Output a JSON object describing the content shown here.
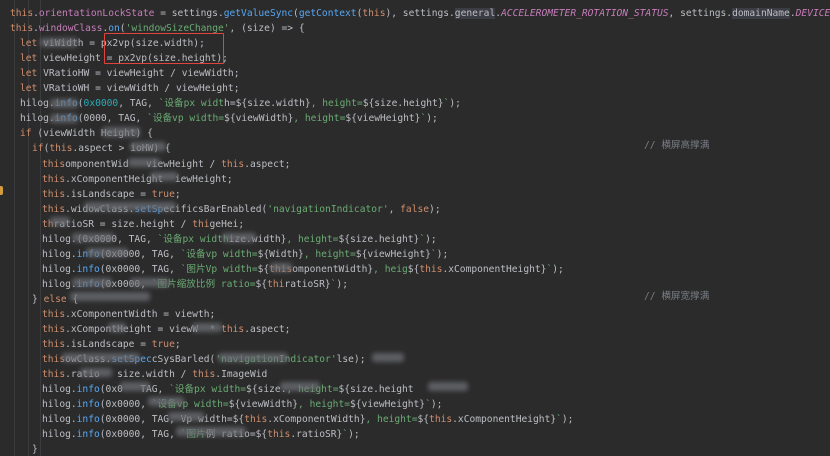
{
  "editor": {
    "lines": [
      {
        "indent": 0,
        "tokens": [
          [
            "kw",
            "this"
          ],
          [
            "",
            "."
          ],
          [
            "fld",
            "orientationLockState"
          ],
          [
            "",
            " = settings."
          ],
          [
            "fn",
            "getValueSync"
          ],
          [
            "",
            "("
          ],
          [
            "fn",
            "getContext"
          ],
          [
            "",
            "("
          ],
          [
            "kw",
            "this"
          ],
          [
            "",
            "), settings."
          ],
          [
            "hl",
            "general"
          ],
          [
            "",
            "."
          ],
          [
            "cst",
            "ACCELEROMETER_ROTATION_STATUS"
          ],
          [
            "",
            ", settings."
          ],
          [
            "hl",
            "domainName"
          ],
          [
            "",
            "."
          ],
          [
            "cst",
            "DEVICE_SHARED"
          ],
          [
            "",
            "};"
          ]
        ]
      },
      {
        "indent": 0,
        "tokens": [
          [
            "kw",
            "this"
          ],
          [
            "",
            "."
          ],
          [
            "fld",
            "windowClass"
          ],
          [
            "",
            "."
          ],
          [
            "fn",
            "on"
          ],
          [
            "",
            "("
          ],
          [
            "str",
            "'windowSizeChange'"
          ],
          [
            "",
            ", (size) => {"
          ]
        ]
      },
      {
        "indent": 1,
        "tokens": [
          [
            "kw",
            "let"
          ],
          [
            "",
            " vi"
          ],
          [
            "",
            ""
          ],
          [
            "",
            "Width = "
          ],
          [
            "ab",
            "px2vp(size.width);"
          ]
        ]
      },
      {
        "indent": 1,
        "tokens": [
          [
            "kw",
            "let"
          ],
          [
            "",
            " viewHeight = "
          ],
          [
            "ab",
            "px2vp(size.height);"
          ]
        ]
      },
      {
        "indent": 1,
        "tokens": [
          [
            "kw",
            "let"
          ],
          [
            "",
            " VRatioHW = viewHeight / viewWidth;"
          ]
        ]
      },
      {
        "indent": 1,
        "tokens": [
          [
            "kw",
            "let"
          ],
          [
            "",
            " VRatioWH = viewWidth / viewHeight;"
          ]
        ]
      },
      {
        "indent": 1,
        "tokens": [
          [
            "",
            "hilog."
          ],
          [
            "fn",
            "info"
          ],
          [
            "",
            "("
          ],
          [
            "num",
            "0x0000"
          ],
          [
            "",
            ", TAG, "
          ],
          [
            "str",
            "`设备px widt"
          ],
          [
            "",
            "h="
          ],
          [
            "",
            "${size.width}"
          ],
          [
            "str",
            ", height="
          ],
          [
            "",
            "${size.height}"
          ],
          [
            "str",
            "`"
          ],
          [
            "",
            ");"
          ]
        ]
      },
      {
        "indent": 1,
        "tokens": [
          [
            "",
            "hilog."
          ],
          [
            "fn",
            "info"
          ],
          [
            "",
            "("
          ],
          [
            "",
            "0000"
          ],
          [
            "",
            ", TAG, "
          ],
          [
            "str",
            "`设备vp width="
          ],
          [
            "",
            "${viewWidth}"
          ],
          [
            "str",
            ", height="
          ],
          [
            "",
            "${viewHeight}"
          ],
          [
            "str",
            "`"
          ],
          [
            "",
            ");"
          ]
        ]
      },
      {
        "indent": 1,
        "tokens": [
          [
            "kw",
            "if"
          ],
          [
            "",
            " (viewWidth "
          ],
          [
            "",
            "Height) {"
          ]
        ]
      },
      {
        "indent": 2,
        "tokens": [
          [
            "kw",
            "if"
          ],
          [
            "",
            "("
          ],
          [
            "kw",
            "this"
          ],
          [
            "",
            ".aspect > "
          ],
          [
            "",
            "ioHW) {"
          ]
        ]
      },
      {
        "indent": 3,
        "tokens": [
          [
            "kw",
            "this"
          ],
          [
            "",
            "omponentWid"
          ],
          [
            "",
            "   viewHeight / "
          ],
          [
            "kw",
            "this"
          ],
          [
            "",
            ".aspect;"
          ]
        ]
      },
      {
        "indent": 3,
        "tokens": [
          [
            "kw",
            "this"
          ],
          [
            "",
            ".xComponentHeight  "
          ],
          [
            "",
            "iewHeight;"
          ]
        ]
      },
      {
        "indent": 3,
        "tokens": [
          [
            "kw",
            "this"
          ],
          [
            "",
            ".isLandscape = "
          ],
          [
            "kw",
            "true"
          ],
          [
            "",
            ";"
          ]
        ]
      },
      {
        "indent": 3,
        "tokens": [
          [
            "kw",
            "this"
          ],
          [
            "",
            ".wi"
          ],
          [
            "",
            "dowClass."
          ],
          [
            "fn",
            "setSp"
          ],
          [
            "",
            "ecifics"
          ],
          [
            "",
            "BarEnabled("
          ],
          [
            "str",
            "'navigationIndicator'"
          ],
          [
            "",
            ", "
          ],
          [
            "kw",
            "false"
          ],
          [
            "",
            ");"
          ]
        ]
      },
      {
        "indent": 3,
        "tokens": [
          [
            "kw",
            "th"
          ],
          [
            "",
            "ratioSR = size.height / "
          ],
          [
            "kw",
            "thi"
          ],
          [
            "",
            "geHei;"
          ]
        ]
      },
      {
        "indent": 3,
        "tokens": [
          [
            "",
            "hilog."
          ],
          [
            "",
            "(0x0000, TAG, "
          ],
          [
            "str",
            "`设备px width"
          ],
          [
            "",
            "ize.width}"
          ],
          [
            "str",
            ", height="
          ],
          [
            "",
            "${size.height}"
          ],
          [
            "str",
            "`"
          ],
          [
            "",
            ");"
          ]
        ]
      },
      {
        "indent": 3,
        "tokens": [
          [
            "",
            "hilog."
          ],
          [
            "fn",
            "info"
          ],
          [
            "",
            "(0x0000, TAG, "
          ],
          [
            "str",
            "`设备vp width="
          ],
          [
            "",
            "${"
          ],
          [
            "",
            "Width}"
          ],
          [
            "str",
            ", height="
          ],
          [
            "",
            "${viewHeight}"
          ],
          [
            "str",
            "`"
          ],
          [
            "",
            ");"
          ]
        ]
      },
      {
        "indent": 3,
        "tokens": [
          [
            "",
            "hilog."
          ],
          [
            "fn",
            "info"
          ],
          [
            "",
            "(0x0000, TAG, "
          ],
          [
            "str",
            "`图片Vp "
          ],
          [
            "str",
            "width="
          ],
          [
            "",
            "${"
          ],
          [
            "kw",
            "this"
          ],
          [
            "",
            "omponentWidth}"
          ],
          [
            "str",
            ", heig"
          ],
          [
            "",
            "${"
          ],
          [
            "kw",
            "this"
          ],
          [
            "",
            ".xComponentHeight}"
          ],
          [
            "str",
            "`"
          ],
          [
            "",
            ");"
          ]
        ]
      },
      {
        "indent": 3,
        "tokens": [
          [
            "",
            "hilog."
          ],
          [
            "fn",
            "info"
          ],
          [
            "",
            "(0x0000, "
          ],
          [
            "str",
            "`图片缩放比例 ratio="
          ],
          [
            "",
            "${"
          ],
          [
            "kw",
            "thi"
          ],
          [
            "",
            "ratioSR}"
          ],
          [
            "str",
            "`"
          ],
          [
            "",
            ");"
          ]
        ]
      },
      {
        "indent": 2,
        "tokens": [
          [
            "",
            "} "
          ],
          [
            "kw",
            "else"
          ],
          [
            "",
            " {"
          ]
        ]
      },
      {
        "indent": 3,
        "tokens": [
          [
            "kw",
            "this"
          ],
          [
            "",
            ".xComponentWidth = view"
          ],
          [
            "",
            "th;"
          ]
        ]
      },
      {
        "indent": 3,
        "tokens": [
          [
            "kw",
            "this"
          ],
          [
            "",
            ".xCompon"
          ],
          [
            "",
            "t"
          ],
          [
            "",
            "Height = viewW"
          ],
          [
            "",
            "  * "
          ],
          [
            "kw",
            "this"
          ],
          [
            "",
            ".aspect;"
          ]
        ]
      },
      {
        "indent": 3,
        "tokens": [
          [
            "kw",
            "this"
          ],
          [
            "",
            ".isLandscape = "
          ],
          [
            "kw",
            "true"
          ],
          [
            "",
            ";"
          ]
        ]
      },
      {
        "indent": 3,
        "tokens": [
          [
            "kw",
            "this"
          ],
          [
            "",
            "owClass."
          ],
          [
            "fn",
            "setSpec"
          ],
          [
            "",
            "cSys"
          ],
          [
            "",
            "Bar"
          ],
          [
            "",
            "led("
          ],
          [
            "str",
            "'navigationIndicator'"
          ],
          [
            "",
            "",
            ""
          ],
          [
            "",
            "lse);"
          ]
        ]
      },
      {
        "indent": 3,
        "tokens": [
          [
            "kw",
            "this"
          ],
          [
            "",
            ".ratio"
          ],
          [
            "",
            "   size.width / "
          ],
          [
            "kw",
            "this"
          ],
          [
            "",
            ".ImageWid"
          ]
        ]
      },
      {
        "indent": 3,
        "tokens": [
          [
            "",
            "hilog."
          ],
          [
            "fn",
            "info"
          ],
          [
            "",
            "(0x0"
          ],
          [
            "",
            "   TAG, "
          ],
          [
            "str",
            "`设备px"
          ],
          [
            "str",
            " width="
          ],
          [
            "",
            "${size."
          ],
          [
            "str",
            ", height="
          ],
          [
            "",
            "${size.height"
          ]
        ]
      },
      {
        "indent": 3,
        "tokens": [
          [
            "",
            "hilog."
          ],
          [
            "fn",
            "info"
          ],
          [
            "",
            "(0x0000, "
          ],
          [
            "",
            ""
          ],
          [
            "str",
            "`设备vp width="
          ],
          [
            "",
            "${viewWidth}"
          ],
          [
            "str",
            ", height="
          ],
          [
            "",
            "${viewHeight}"
          ],
          [
            "str",
            "`"
          ],
          [
            "",
            ");"
          ]
        ]
      },
      {
        "indent": 3,
        "tokens": [
          [
            "",
            "hilog."
          ],
          [
            "fn",
            "info"
          ],
          [
            "",
            "(0x0000, TAG, "
          ],
          [
            "",
            "Vp width="
          ],
          [
            "",
            "${"
          ],
          [
            "kw",
            "this"
          ],
          [
            "",
            ".xComponentWidth}"
          ],
          [
            "str",
            ", height="
          ],
          [
            "",
            "${"
          ],
          [
            "kw",
            "this"
          ],
          [
            "",
            ".xComponentHeight}"
          ],
          [
            "str",
            "`"
          ],
          [
            "",
            ");"
          ]
        ]
      },
      {
        "indent": 3,
        "tokens": [
          [
            "",
            "hilog."
          ],
          [
            "fn",
            "info"
          ],
          [
            "",
            "(0x0000, TAG, "
          ],
          [
            "str",
            "`图片"
          ],
          [
            "",
            "例 ratio="
          ],
          [
            "",
            "${"
          ],
          [
            "kw",
            "this"
          ],
          [
            "",
            ".ratioSR}"
          ],
          [
            "str",
            "`"
          ],
          [
            "",
            ");"
          ]
        ]
      },
      {
        "indent": 2,
        "tokens": [
          [
            "",
            "}"
          ]
        ]
      }
    ],
    "comment_landscape_high": "// 横屏高撑满",
    "comment_landscape_wide": "// 横屏宽撑满"
  },
  "colors": {
    "background": "#2b2b2b",
    "keyword": "#cf8e6d",
    "function": "#56a8f5",
    "string": "#6aab73",
    "field": "#c77dbb",
    "highlight_box": "#e0443c"
  }
}
